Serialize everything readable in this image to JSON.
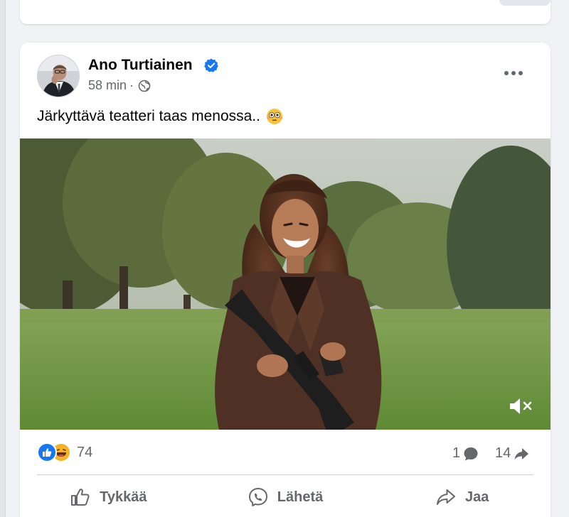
{
  "post": {
    "author": "Ano Turtiainen",
    "time": "58 min",
    "separator": "·",
    "text": "Järkyttävä teatteri taas menossa..",
    "emoji_icon": "flushed-face-emoji",
    "verified_icon": "verified-badge-icon",
    "audience_icon": "globe-icon",
    "video_muted": true
  },
  "stats": {
    "reaction_icons": [
      "like",
      "haha"
    ],
    "reaction_count": "74",
    "comment_count": "1",
    "share_count": "14"
  },
  "actions": {
    "like_label": "Tykkää",
    "send_label": "Lähetä",
    "share_label": "Jaa"
  },
  "colors": {
    "background": "#f0f2f5",
    "card": "#ffffff",
    "verified": "#1877f2",
    "like_blue": "#1877f2",
    "haha_yellow": "#f7b125",
    "secondary_text": "#65676b"
  }
}
